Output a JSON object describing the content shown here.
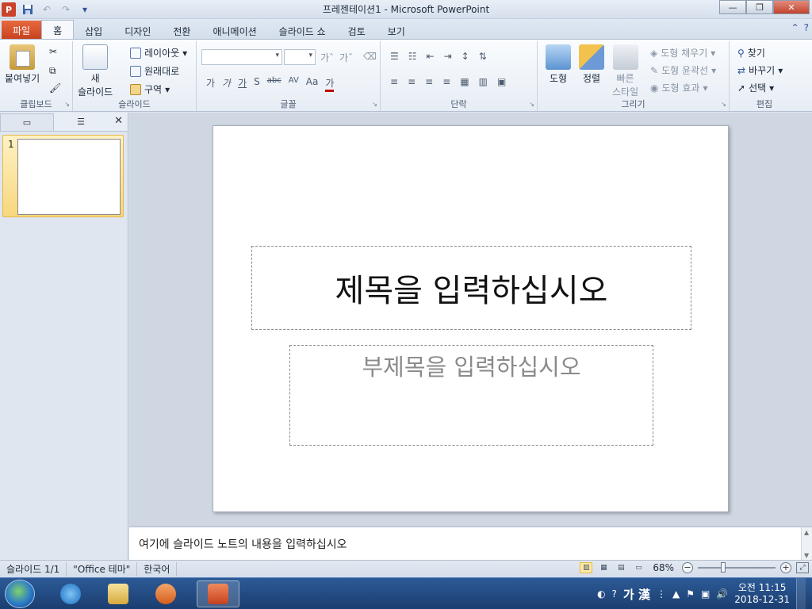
{
  "window": {
    "title": "프레젠테이션1 - Microsoft PowerPoint",
    "app_icon_letter": "P"
  },
  "tabs": [
    {
      "label": "파일"
    },
    {
      "label": "홈"
    },
    {
      "label": "삽입"
    },
    {
      "label": "디자인"
    },
    {
      "label": "전환"
    },
    {
      "label": "애니메이션"
    },
    {
      "label": "슬라이드 쇼"
    },
    {
      "label": "검토"
    },
    {
      "label": "보기"
    }
  ],
  "ribbon": {
    "clipboard": {
      "label": "클립보드",
      "paste": "붙여넣기"
    },
    "slides": {
      "label": "슬라이드",
      "new_slide_line1": "새",
      "new_slide_line2": "슬라이드",
      "layout": "레이아웃",
      "reset": "원래대로",
      "section": "구역"
    },
    "font": {
      "label": "글꼴",
      "glyphs": [
        "가",
        "가",
        "가",
        "S",
        "abc",
        "AV",
        "Aa",
        "가"
      ]
    },
    "paragraph": {
      "label": "단락"
    },
    "drawing": {
      "label": "그리기",
      "shapes": "도형",
      "arrange": "정렬",
      "quick_styles_line1": "빠른",
      "quick_styles_line2": "스타일",
      "shape_fill": "도형 채우기",
      "shape_outline": "도형 윤곽선",
      "shape_effects": "도형 효과"
    },
    "editing": {
      "label": "편집",
      "find": "찾기",
      "replace": "바꾸기",
      "select": "선택"
    }
  },
  "left_pane": {
    "slide_number": "1"
  },
  "slide": {
    "title_placeholder": "제목을 입력하십시오",
    "subtitle_placeholder": "부제목을 입력하십시오"
  },
  "notes": {
    "placeholder": "여기에 슬라이드 노트의 내용을 입력하십시오"
  },
  "status_bar": {
    "slide_info": "슬라이드 1/1",
    "theme": "\"Office 테마\"",
    "language": "한국어",
    "zoom": "68%",
    "zoom_level_percent": 68
  },
  "taskbar": {
    "ime_label": "가 漢",
    "clock_time": "오전 11:15",
    "clock_date": "2018-12-31"
  },
  "colors": {
    "file_tab": "#c6401e",
    "selected_thumb": "#f7d77e",
    "taskbar": "#1b3e70"
  }
}
